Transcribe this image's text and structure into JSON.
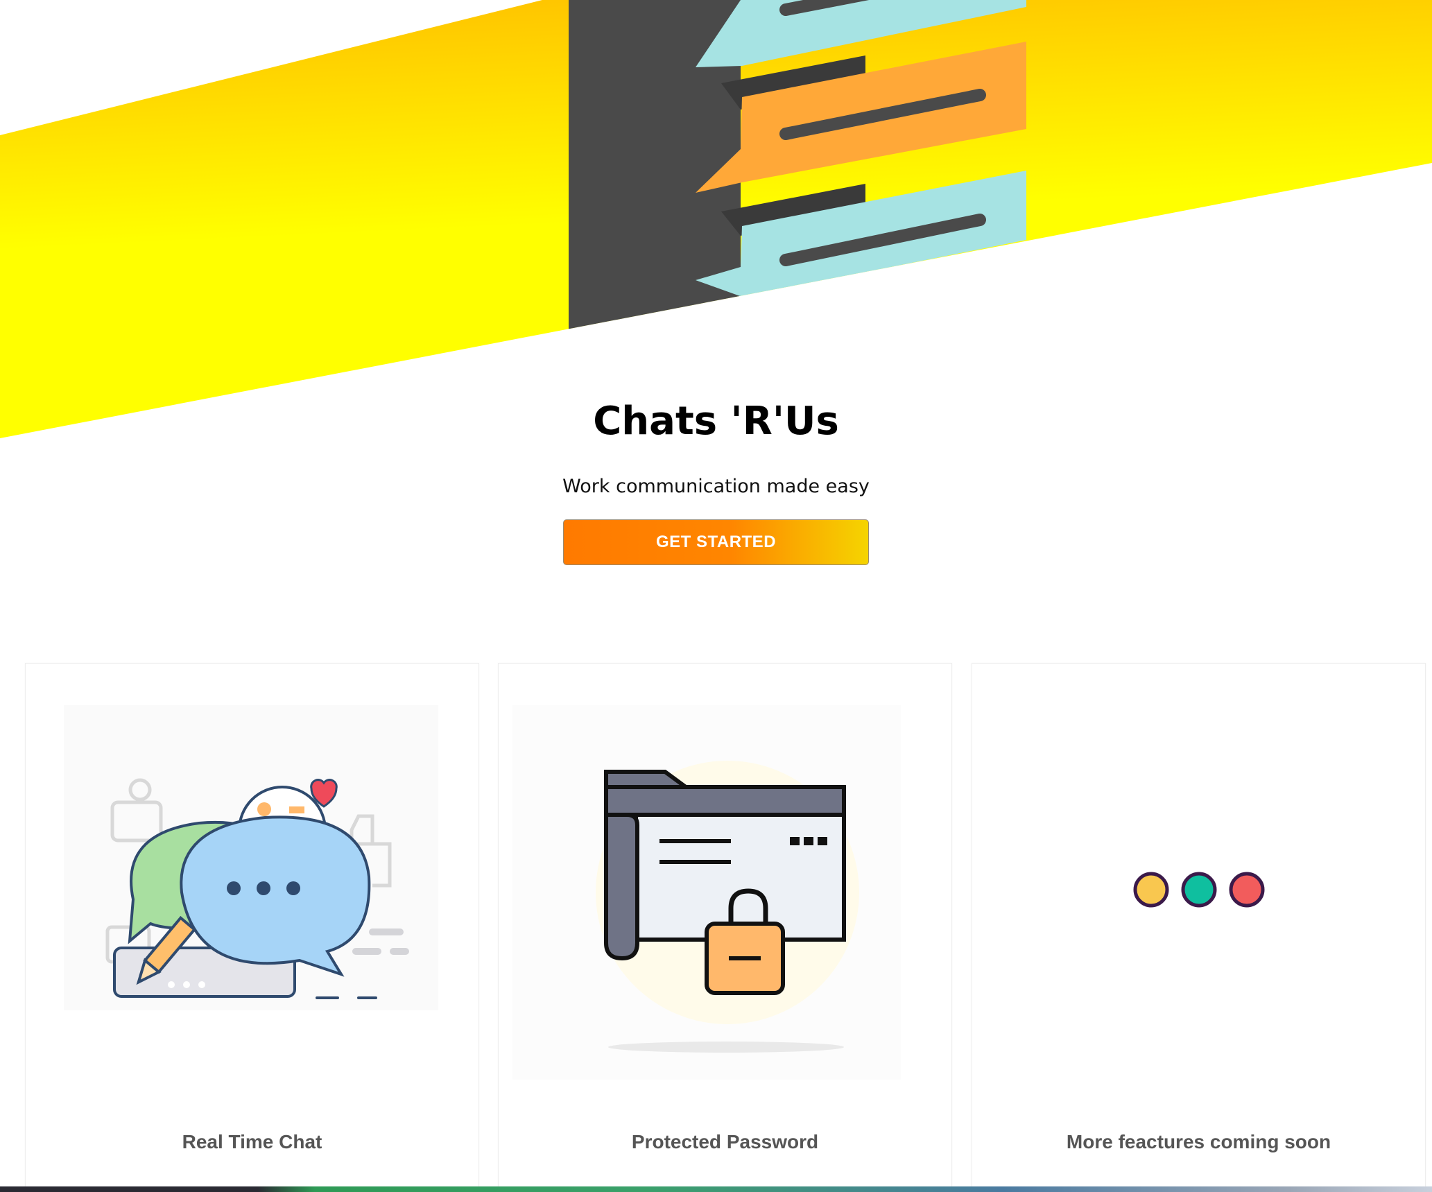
{
  "hero": {
    "title": "Chats 'R'Us",
    "tagline": "Work communication made easy",
    "cta_label": "GET STARTED"
  },
  "features": [
    {
      "label": "Real Time Chat",
      "illustration": "chat-bubbles-illustration"
    },
    {
      "label": "Protected Password",
      "illustration": "locked-folder-illustration"
    },
    {
      "label": "More feactures coming soon",
      "illustration": "three-dots-illustration"
    }
  ],
  "colors": {
    "banner_yellow_start": "#ffc200",
    "banner_yellow_end": "#ffff00",
    "banner_dark": "#4a4a4a",
    "bubble_orange": "#ffa838",
    "bubble_cyan": "#a6e3e3",
    "cta_orange": "#ff7a00",
    "cta_yellow": "#f5d400",
    "dot_yellow": "#f9c74f",
    "dot_teal": "#0fbf9f",
    "dot_red": "#f25c5c"
  }
}
